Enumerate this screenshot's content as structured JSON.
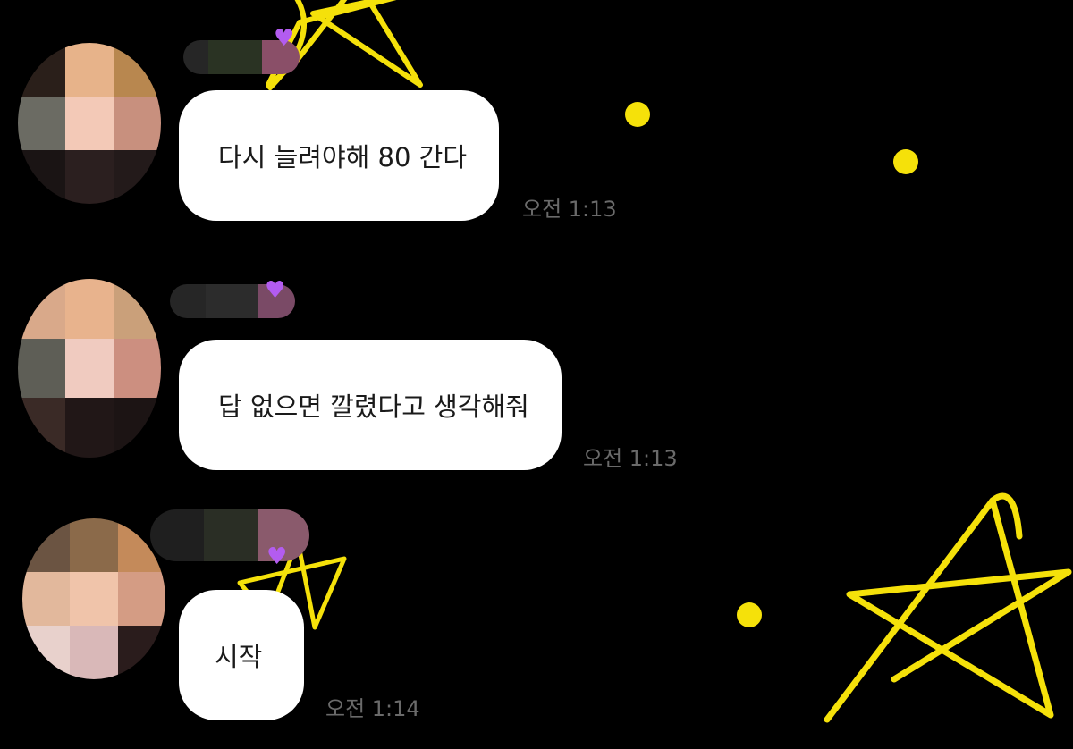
{
  "theme": {
    "background": "#000000",
    "accent_star": "#f5e10a",
    "bubble_bg": "#ffffff",
    "time_color": "#6a6a6a",
    "heart_color": "#b35cf0"
  },
  "messages": [
    {
      "text": "다시 늘려야해 80 간다",
      "time": "오전 1:13"
    },
    {
      "text": "답 없으면 깔렸다고 생각해줘",
      "time": "오전 1:13"
    },
    {
      "text": "시작",
      "time": "오전 1:14"
    }
  ],
  "icons": {
    "heart": "purple-heart-icon",
    "star": "star-doodle-icon",
    "dot": "yellow-dot-icon"
  }
}
